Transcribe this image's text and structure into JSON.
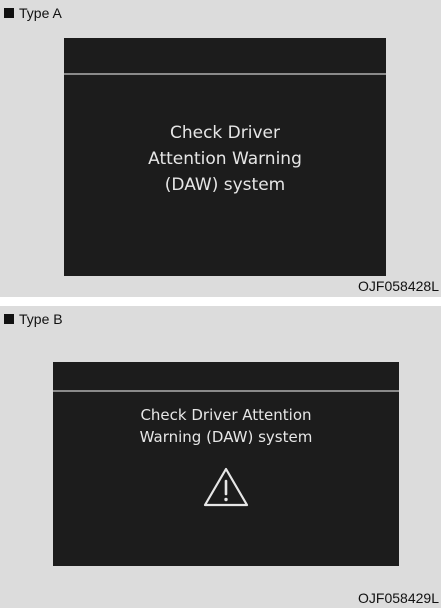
{
  "panels": [
    {
      "label": "Type A",
      "message": "Check Driver\nAttention Warning\n(DAW) system",
      "code": "OJF058428L"
    },
    {
      "label": "Type B",
      "message": "Check Driver Attention\nWarning (DAW) system",
      "icon": "warning-triangle-icon",
      "code": "OJF058429L"
    }
  ],
  "colors": {
    "panel_background": "#dcdcdc",
    "screen_background": "#1c1c1c",
    "screen_text": "#e6e6e6",
    "divider": "#8a8a8a"
  }
}
